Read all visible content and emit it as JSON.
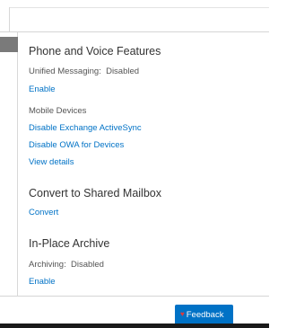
{
  "sections": {
    "phone_voice": {
      "title": "Phone and Voice Features",
      "unified_messaging_label": "Unified Messaging:",
      "unified_messaging_value": "Disabled",
      "enable_link": "Enable",
      "mobile_devices_label": "Mobile Devices",
      "disable_activesync_link": "Disable Exchange ActiveSync",
      "disable_owa_link": "Disable OWA for Devices",
      "view_details_link": "View details"
    },
    "shared_mailbox": {
      "title": "Convert to Shared Mailbox",
      "convert_link": "Convert"
    },
    "archive": {
      "title": "In-Place Archive",
      "archiving_label": "Archiving:",
      "archiving_value": "Disabled",
      "enable_link": "Enable"
    }
  },
  "feedback": {
    "label": "Feedback",
    "icon": "feedback-heart-icon"
  },
  "colors": {
    "link": "#0072c6",
    "feedback_bg": "#0072c6",
    "feedback_icon": "#e03a3a",
    "selected_row": "#7a7a7a"
  }
}
